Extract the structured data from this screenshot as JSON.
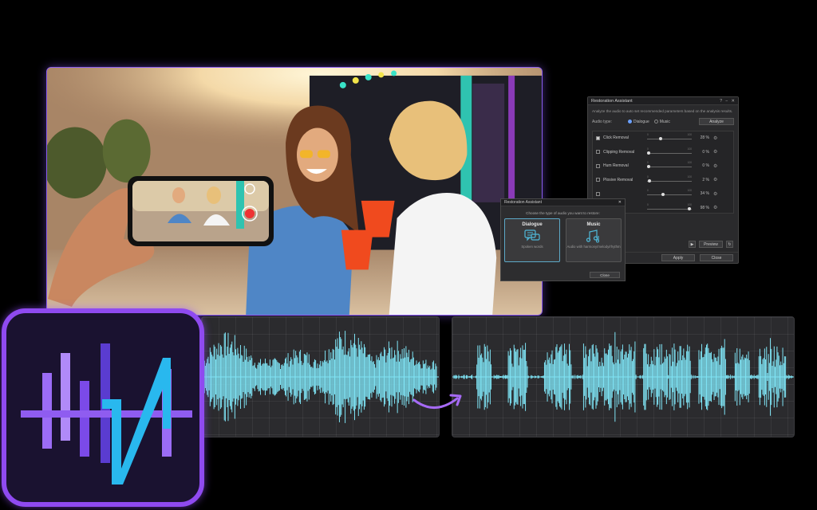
{
  "restoration_assistant": {
    "title": "Restoration Assistant",
    "help": "?",
    "close_glyph": "✕",
    "description": "Analyze the audio to auto set recommended parameters based on the analysis results.",
    "audio_type_label": "Audio type:",
    "options": {
      "dialogue": "Dialogue",
      "music": "Music"
    },
    "analyze_label": "Analyze",
    "rows": [
      {
        "name": "Click Removal",
        "checked": true,
        "value": "28 %",
        "level": 28
      },
      {
        "name": "Clipping Removal",
        "checked": false,
        "value": "0 %",
        "level": 0
      },
      {
        "name": "Hum Removal",
        "checked": false,
        "value": "0 %",
        "level": 0
      },
      {
        "name": "Plosive Removal",
        "checked": false,
        "value": "2 %",
        "level": 2
      },
      {
        "name": "",
        "checked": false,
        "value": "34 %",
        "level": 34
      },
      {
        "name": "",
        "checked": false,
        "value": "98 %",
        "level": 98
      }
    ],
    "tick_min": "0",
    "tick_max": "100",
    "preview_label": "Preview",
    "apply_label": "Apply",
    "close_label": "Close"
  },
  "audio_type_popup": {
    "title": "Restoration Assistant",
    "close_glyph": "✕",
    "description": "Choose the type of audio you want to restore:",
    "dialogue": {
      "title": "Dialogue",
      "subtitle": "Spoken words"
    },
    "music": {
      "title": "Music",
      "subtitle": "Audio with harmony/melody/rhythm"
    },
    "close_label": "Close"
  },
  "colors": {
    "accent_purple": "#8f4af0",
    "waveform_cyan": "#7fe4f5",
    "logo_purple": "#9b6cf5",
    "logo_cyan": "#29b8ee"
  }
}
